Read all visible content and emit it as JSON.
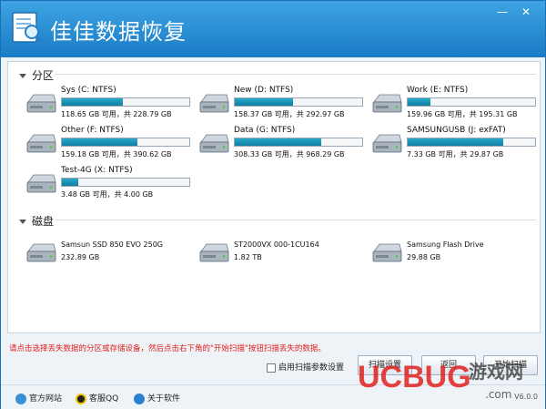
{
  "app": {
    "title": "佳佳数据恢复",
    "version": "V6.0.0"
  },
  "window_controls": {
    "minimize": "—",
    "close": "✕"
  },
  "sections": {
    "partitions": "分区",
    "disks": "磁盘"
  },
  "partitions": [
    {
      "name": "Sys (C: NTFS)",
      "info": "118.65 GB 可用，共 228.79 GB",
      "used": 0.48
    },
    {
      "name": "New (D: NTFS)",
      "info": "158.37 GB 可用，共 292.97 GB",
      "used": 0.46
    },
    {
      "name": "Work (E: NTFS)",
      "info": "159.96 GB 可用，共 195.31 GB",
      "used": 0.18
    },
    {
      "name": "Other (F: NTFS)",
      "info": "159.18 GB 可用，共 390.62 GB",
      "used": 0.59
    },
    {
      "name": "Data (G: NTFS)",
      "info": "308.33 GB 可用，共 968.29 GB",
      "used": 0.68
    },
    {
      "name": "SAMSUNGUSB (J: exFAT)",
      "info": "7.33 GB 可用，共 29.87 GB",
      "used": 0.75
    },
    {
      "name": "Test-4G (X: NTFS)",
      "info": "3.48 GB 可用，共 4.00 GB",
      "used": 0.13
    }
  ],
  "disks": [
    {
      "name": "Samsun SSD 850 EVO 250G",
      "size": "232.89 GB"
    },
    {
      "name": "ST2000VX 000-1CU164",
      "size": "1.82 TB"
    },
    {
      "name": "Samsung Flash Drive",
      "size": "29.88 GB"
    }
  ],
  "hint": "请点击选择丢失数据的分区或存储设备，然后点击右下角的\"开始扫描\"按钮扫描丢失的数据。",
  "options": {
    "advanced_scan": "启用扫描参数设置"
  },
  "buttons": {
    "settings": "扫描设置",
    "back": "返回",
    "start": "开始扫描"
  },
  "footer": {
    "website": "官方网站",
    "support": "客服QQ",
    "about": "关于软件"
  },
  "watermark": {
    "brand": "UCBUG",
    "cn": "游戏网",
    "domain": ".com"
  }
}
